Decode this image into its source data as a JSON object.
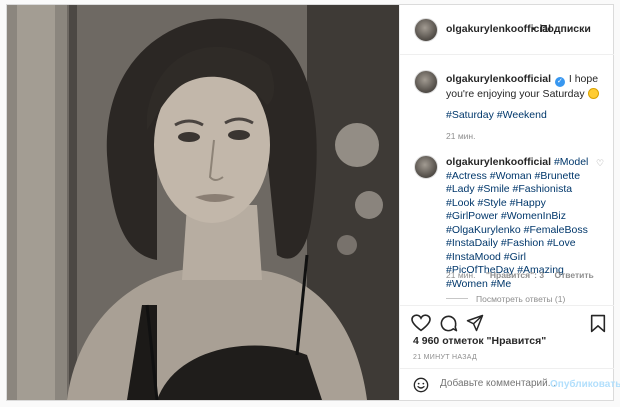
{
  "post": {
    "photo_alt": "olgakurylenkoofficial photo"
  },
  "header": {
    "username": "olgakurylenkoofficial",
    "dot": "•",
    "follow_label": "Подписки"
  },
  "caption": {
    "username": "olgakurylenkoofficial",
    "text": " I hope you're enjoying your Saturday ",
    "tags": [
      "#Saturday",
      "#Weekend"
    ],
    "time": "21 мин."
  },
  "comment": {
    "username": "olgakurylenkoofficial",
    "text": "#Model #Actress #Woman #Brunette #Lady #Smile #Fashionista #Look #Style #Happy #GirlPower #WomenInBiz #OlgaKurylenko #FemaleBoss #InstaDaily #Fashion #Love #InstaMood #Girl #PicOfTheDay #Amazing #Women #Me",
    "time": "21 мин.",
    "likes": "\"Нравится\": 3",
    "reply": "Ответить",
    "view_replies": "Посмотреть ответы (1)"
  },
  "actions": {
    "likes": "4 960 отметок \"Нравится\"",
    "ago": "21 МИНУТ НАЗАД"
  },
  "add_comment": {
    "placeholder": "Добавьте комментарий...",
    "post_label": "Опубликовать"
  },
  "colors": {
    "accent": "#3897f0",
    "link": "#00376b",
    "muted": "#8e8e8e",
    "post_disabled": "#b2dffc"
  },
  "icons": [
    "heart-outline-icon",
    "comment-icon",
    "share-icon",
    "bookmark-icon",
    "emoji-icon",
    "verified-badge-icon"
  ]
}
